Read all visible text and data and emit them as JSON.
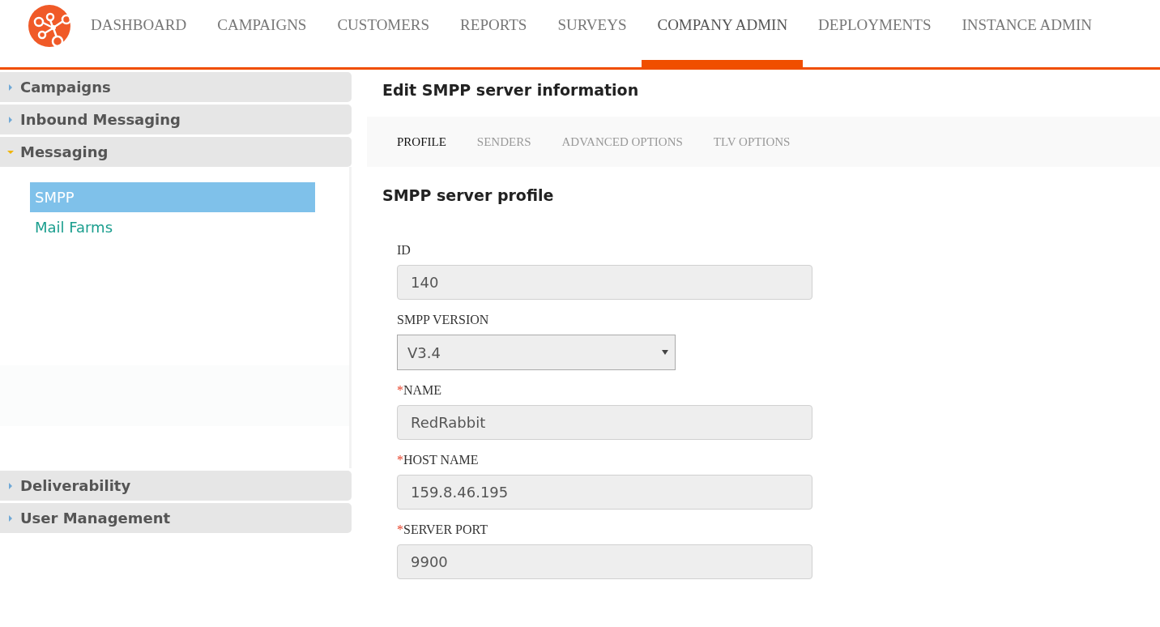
{
  "nav": [
    {
      "label": "DASHBOARD",
      "selected": false
    },
    {
      "label": "CAMPAIGNS",
      "selected": false
    },
    {
      "label": "CUSTOMERS",
      "selected": false
    },
    {
      "label": "REPORTS",
      "selected": false
    },
    {
      "label": "SURVEYS",
      "selected": false
    },
    {
      "label": "COMPANY ADMIN",
      "selected": true
    },
    {
      "label": "DEPLOYMENTS",
      "selected": false
    },
    {
      "label": "INSTANCE ADMIN",
      "selected": false
    }
  ],
  "sidebar": {
    "sections": [
      {
        "title": "Campaigns",
        "expanded": false
      },
      {
        "title": "Inbound Messaging",
        "expanded": false
      },
      {
        "title": "Messaging",
        "expanded": true,
        "items": [
          {
            "label": "SMPP",
            "selected": true
          },
          {
            "label": "Mail Farms",
            "selected": false
          }
        ]
      },
      {
        "title": "Deliverability",
        "expanded": false
      },
      {
        "title": "User Management",
        "expanded": false
      }
    ]
  },
  "page_title": "Edit SMPP server information",
  "tabs": [
    {
      "label": "PROFILE",
      "selected": true
    },
    {
      "label": "SENDERS",
      "selected": false
    },
    {
      "label": "ADVANCED OPTIONS",
      "selected": false
    },
    {
      "label": "TLV OPTIONS",
      "selected": false
    }
  ],
  "section_title": "SMPP server profile",
  "fields": [
    {
      "kind": "input",
      "label": "ID",
      "value": "140"
    },
    {
      "kind": "select",
      "label": "SMPP VERSION",
      "value": "V3.4"
    },
    {
      "kind": "input",
      "required_mark": "*",
      "label": "NAME",
      "value": "RedRabbit"
    },
    {
      "kind": "input",
      "required_mark": "*",
      "label": "HOST NAME",
      "value": "159.8.46.195"
    },
    {
      "kind": "input",
      "required_mark": "*",
      "label": "SERVER PORT",
      "value": "9900"
    }
  ]
}
